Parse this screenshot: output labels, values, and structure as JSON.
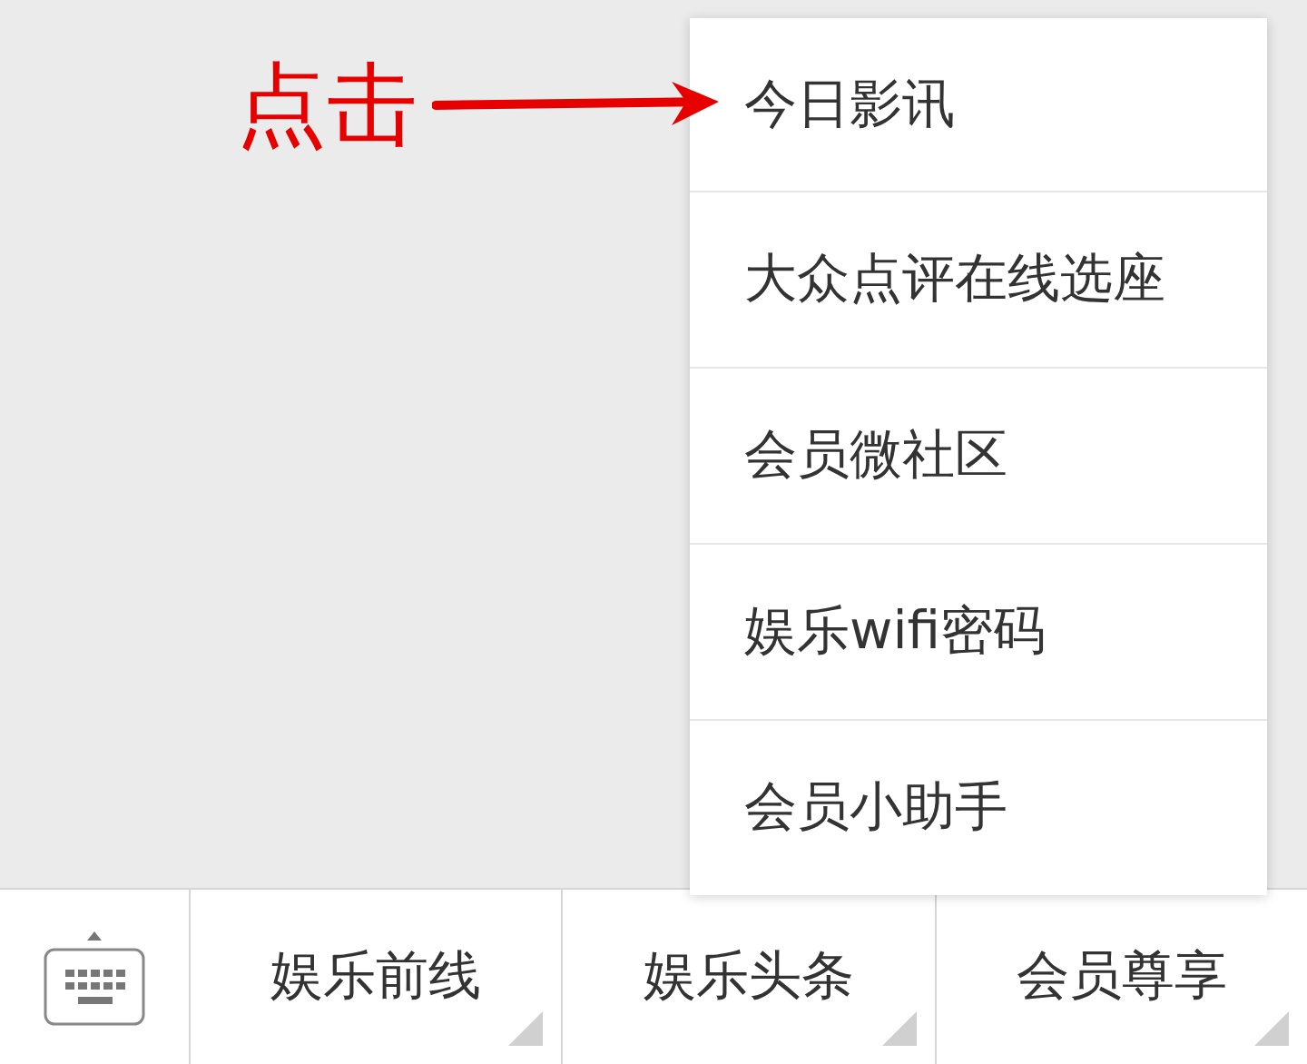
{
  "annotation": {
    "text": "点击"
  },
  "menu": {
    "items": [
      {
        "label": "今日影讯"
      },
      {
        "label": "大众点评在线选座"
      },
      {
        "label": "会员微社区"
      },
      {
        "label": "娱乐wifi密码"
      },
      {
        "label": "会员小助手"
      }
    ]
  },
  "bottom_bar": {
    "tabs": [
      {
        "label": "娱乐前线"
      },
      {
        "label": "娱乐头条"
      },
      {
        "label": "会员尊享"
      }
    ]
  }
}
